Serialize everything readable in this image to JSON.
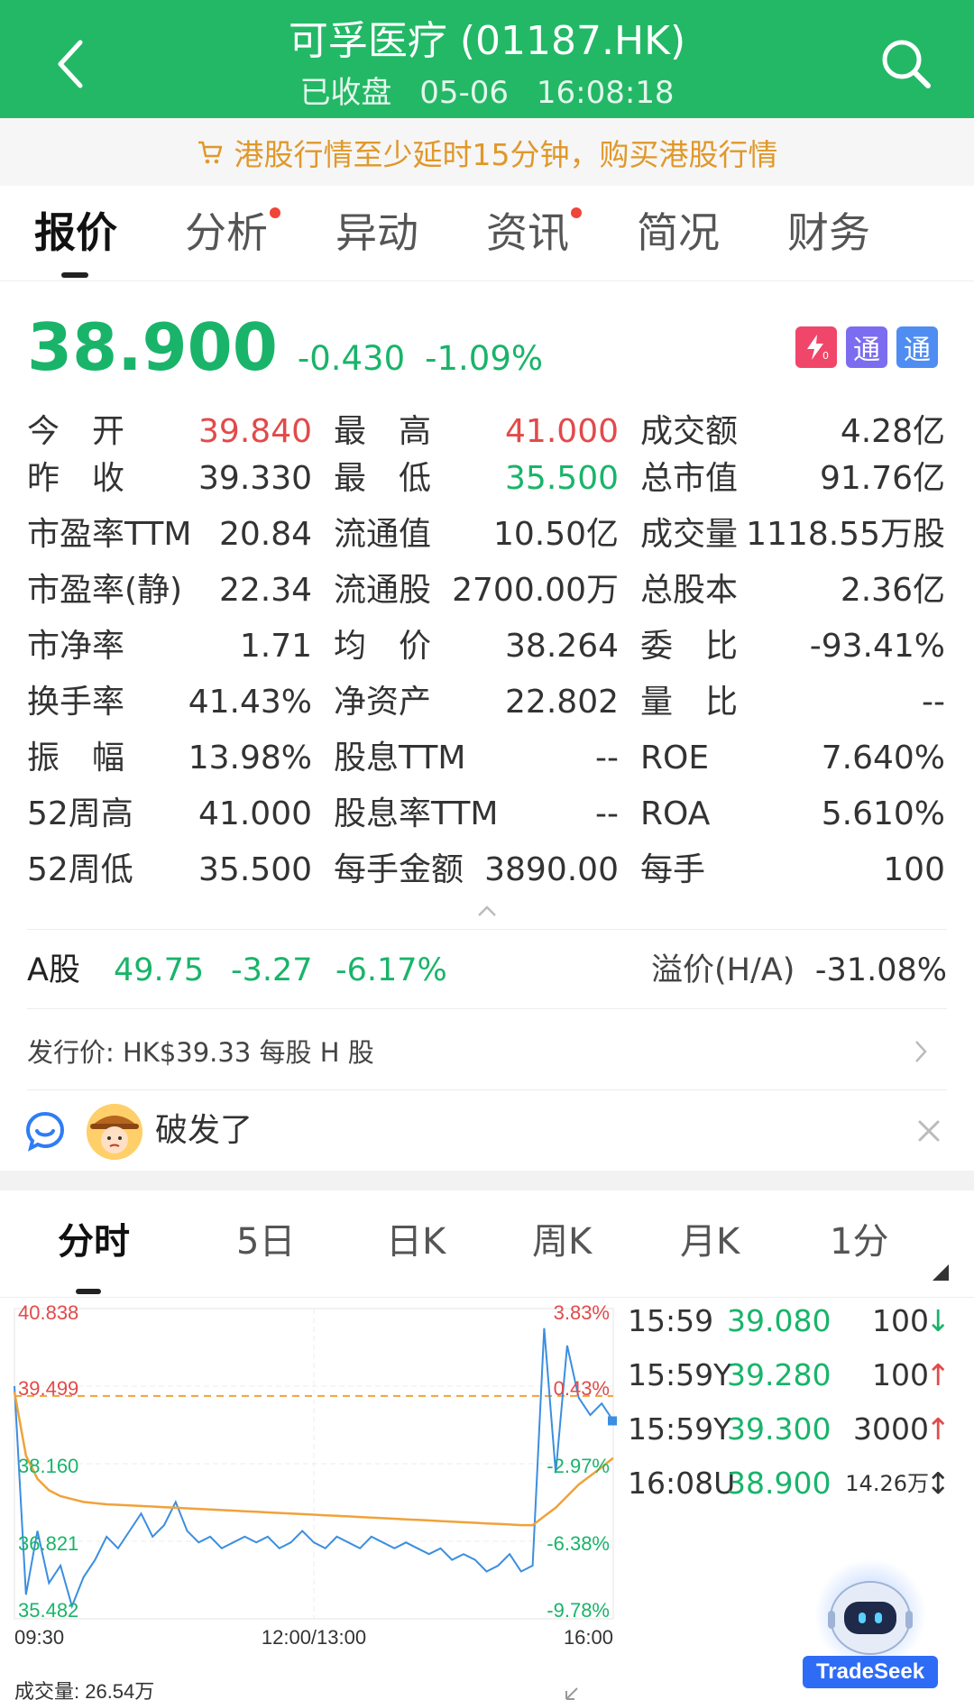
{
  "header": {
    "title": "可孚医疗 (01187.HK)",
    "status": "已收盘",
    "date": "05-06",
    "time": "16:08:18"
  },
  "notice": {
    "text": "港股行情至少延时15分钟，购买港股行情"
  },
  "tabs": [
    {
      "label": "报价",
      "dot": false
    },
    {
      "label": "分析",
      "dot": true
    },
    {
      "label": "异动",
      "dot": false
    },
    {
      "label": "资讯",
      "dot": true
    },
    {
      "label": "简况",
      "dot": false
    },
    {
      "label": "财务",
      "dot": false
    }
  ],
  "quote": {
    "price": "38.900",
    "change": "-0.430",
    "change_pct": "-1.09%",
    "badges": [
      "通",
      "通"
    ]
  },
  "stats": {
    "col1": [
      {
        "label": "今　开",
        "value": "39.840",
        "color": "#e24a4a"
      },
      {
        "label": "昨　收",
        "value": "39.330",
        "color": "#333333"
      },
      {
        "label": "市盈率TTM",
        "value": "20.84",
        "color": "#333333"
      },
      {
        "label": "市盈率(静)",
        "value": "22.34",
        "color": "#333333"
      },
      {
        "label": "市净率",
        "value": "1.71",
        "color": "#333333"
      },
      {
        "label": "换手率",
        "value": "41.43%",
        "color": "#333333"
      },
      {
        "label": "振　幅",
        "value": "13.98%",
        "color": "#333333"
      },
      {
        "label": "52周高",
        "value": "41.000",
        "color": "#333333"
      },
      {
        "label": "52周低",
        "value": "35.500",
        "color": "#333333"
      }
    ],
    "col2": [
      {
        "label": "最　高",
        "value": "41.000",
        "color": "#e24a4a"
      },
      {
        "label": "最　低",
        "value": "35.500",
        "color": "#19b46a"
      },
      {
        "label": "流通值",
        "value": "10.50亿",
        "color": "#333333"
      },
      {
        "label": "流通股",
        "value": "2700.00万",
        "color": "#333333"
      },
      {
        "label": "均　价",
        "value": "38.264",
        "color": "#333333"
      },
      {
        "label": "净资产",
        "value": "22.802",
        "color": "#333333"
      },
      {
        "label": "股息TTM",
        "value": "--",
        "color": "#333333"
      },
      {
        "label": "股息率TTM",
        "value": "--",
        "color": "#333333"
      },
      {
        "label": "每手金额",
        "value": "3890.00",
        "color": "#333333"
      }
    ],
    "col3": [
      {
        "label": "成交额",
        "value": "4.28亿",
        "color": "#333333"
      },
      {
        "label": "总市值",
        "value": "91.76亿",
        "color": "#333333"
      },
      {
        "label": "成交量",
        "value": "1118.55万股",
        "color": "#333333"
      },
      {
        "label": "总股本",
        "value": "2.36亿",
        "color": "#333333"
      },
      {
        "label": "委　比",
        "value": "-93.41%",
        "color": "#333333"
      },
      {
        "label": "量　比",
        "value": "--",
        "color": "#333333"
      },
      {
        "label": "ROE",
        "value": "7.640%",
        "color": "#333333"
      },
      {
        "label": "ROA",
        "value": "5.610%",
        "color": "#333333"
      },
      {
        "label": "每手",
        "value": "100",
        "color": "#333333"
      }
    ]
  },
  "a_share": {
    "label": "A股",
    "price": "49.75",
    "change": "-3.27",
    "change_pct": "-6.17%",
    "premium_label": "溢价(H/A)",
    "premium_value": "-31.08%"
  },
  "issue_price": {
    "text": "发行价: HK$39.33 每股 H 股"
  },
  "comment": {
    "text": "破发了"
  },
  "chart_tabs": [
    "分时",
    "5日",
    "日K",
    "周K",
    "月K",
    "1分"
  ],
  "chart_data": {
    "type": "line",
    "y_left_labels": [
      "40.838",
      "39.499",
      "38.160",
      "36.821",
      "35.482"
    ],
    "y_right_labels": [
      "3.83%",
      "0.43%",
      "-2.97%",
      "-6.38%",
      "-9.78%"
    ],
    "x_labels": [
      "09:30",
      "12:00/13:00",
      "16:00"
    ],
    "ylim": [
      35.482,
      40.838
    ],
    "prev_close": 39.33,
    "series": [
      {
        "values": [
          39.5,
          35.9,
          37.0,
          36.1,
          36.4,
          35.7,
          36.2,
          36.5,
          36.9,
          36.7,
          37.0,
          37.3,
          36.9,
          37.1,
          37.5,
          37.0,
          36.8,
          36.9,
          36.7,
          36.8,
          36.9,
          36.8,
          36.9,
          36.7,
          36.8,
          37.0,
          36.8,
          36.7,
          36.9,
          36.8,
          36.7,
          36.9,
          36.8,
          36.7,
          36.8,
          36.7,
          36.6,
          36.7,
          36.5,
          36.6,
          36.5,
          36.3,
          36.4,
          36.6,
          36.3,
          36.4,
          40.5,
          38.0,
          40.2,
          39.3,
          39.0,
          39.2,
          38.9
        ]
      },
      {
        "values": [
          39.4,
          38.3,
          37.9,
          37.7,
          37.6,
          37.55,
          37.5,
          37.48,
          37.46,
          37.45,
          37.44,
          37.43,
          37.42,
          37.41,
          37.4,
          37.39,
          37.38,
          37.37,
          37.36,
          37.35,
          37.34,
          37.33,
          37.32,
          37.31,
          37.3,
          37.29,
          37.28,
          37.27,
          37.26,
          37.25,
          37.24,
          37.23,
          37.22,
          37.21,
          37.2,
          37.19,
          37.18,
          37.17,
          37.16,
          37.15,
          37.14,
          37.13,
          37.12,
          37.11,
          37.1,
          37.1,
          37.25,
          37.4,
          37.6,
          37.8,
          37.95,
          38.1,
          38.26
        ]
      }
    ]
  },
  "volume_label": "成交量: 26.54万",
  "ticks": [
    {
      "time": "15:59",
      "price": "39.080",
      "vol": "100",
      "arrow": "↓",
      "arrow_color": "#19b46a"
    },
    {
      "time": "15:59Y",
      "price": "39.280",
      "vol": "100",
      "arrow": "↑",
      "arrow_color": "#e24a4a"
    },
    {
      "time": "15:59Y",
      "price": "39.300",
      "vol": "3000",
      "arrow": "↑",
      "arrow_color": "#e24a4a"
    },
    {
      "time": "16:08U",
      "price": "38.900",
      "vol": "14.26万",
      "arrow": "↕",
      "arrow_color": "#333333"
    }
  ],
  "assistant": {
    "label": "TradeSeek"
  }
}
